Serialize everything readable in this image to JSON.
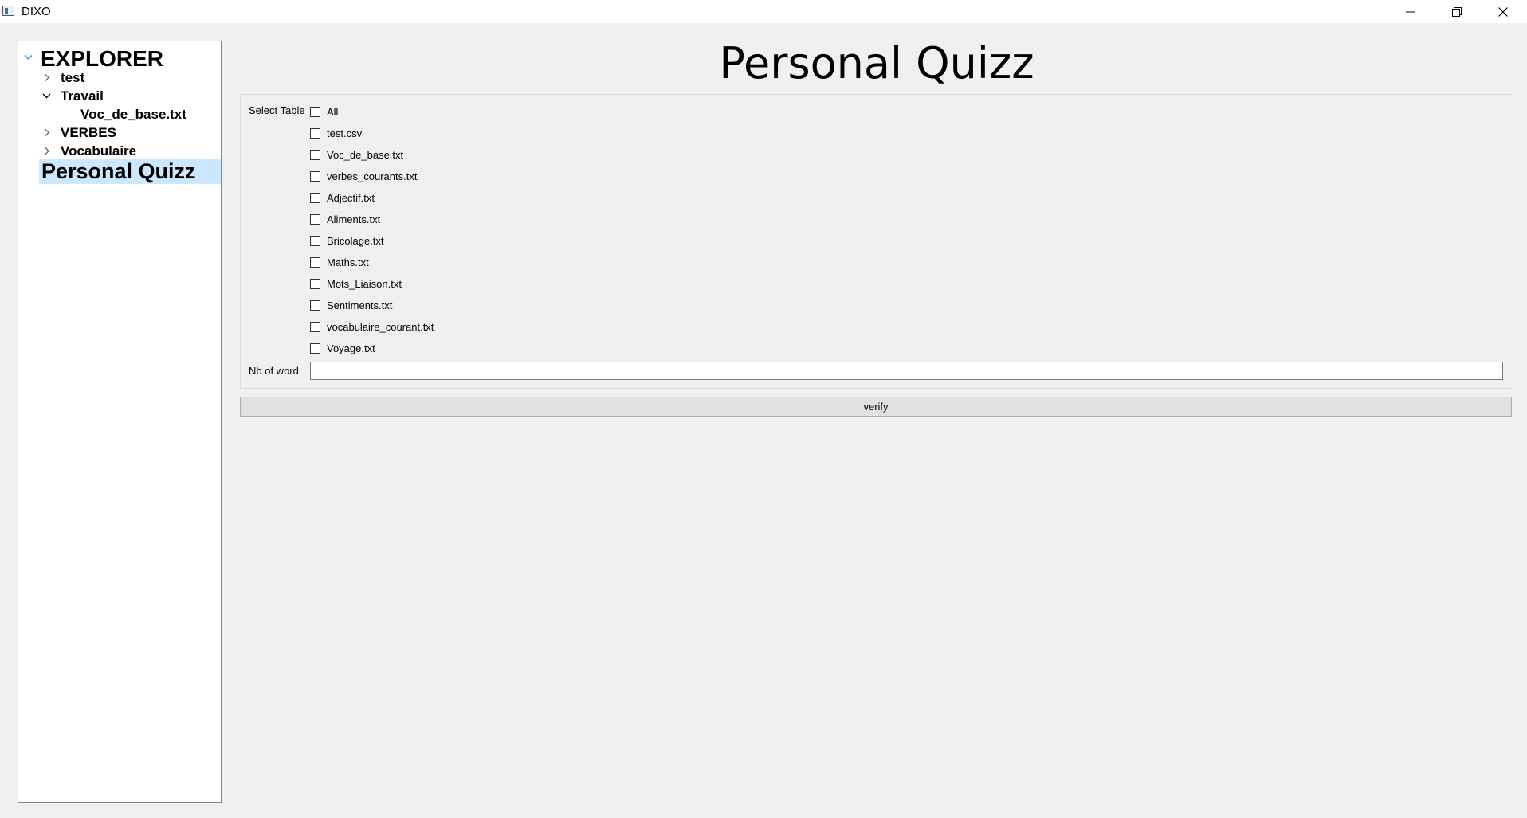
{
  "window": {
    "title": "DIXO",
    "controls": [
      "minimize-icon",
      "restore-icon",
      "close-icon"
    ]
  },
  "explorer": {
    "root_label": "EXPLORER",
    "items": [
      {
        "label": "test",
        "expanded": false
      },
      {
        "label": "Travail",
        "expanded": true,
        "children": [
          "Voc_de_base.txt"
        ]
      },
      {
        "label": "VERBES",
        "expanded": false
      },
      {
        "label": "Vocabulaire",
        "expanded": false
      }
    ],
    "selected_label": "Personal Quizz",
    "selection_color": "#cce8ff"
  },
  "main": {
    "title": "Personal Quizz",
    "select_table_label": "Select Table",
    "tables": [
      {
        "label": "All",
        "checked": false
      },
      {
        "label": "test.csv",
        "checked": false
      },
      {
        "label": "Voc_de_base.txt",
        "checked": false
      },
      {
        "label": "verbes_courants.txt",
        "checked": false
      },
      {
        "label": "Adjectif.txt",
        "checked": false
      },
      {
        "label": "Aliments.txt",
        "checked": false
      },
      {
        "label": "Bricolage.txt",
        "checked": false
      },
      {
        "label": "Maths.txt",
        "checked": false
      },
      {
        "label": "Mots_Liaison.txt",
        "checked": false
      },
      {
        "label": "Sentiments.txt",
        "checked": false
      },
      {
        "label": "vocabulaire_courant.txt",
        "checked": false
      },
      {
        "label": "Voyage.txt",
        "checked": false
      }
    ],
    "nb_word_label": "Nb of word",
    "nb_word_value": "",
    "verify_label": "verify"
  }
}
